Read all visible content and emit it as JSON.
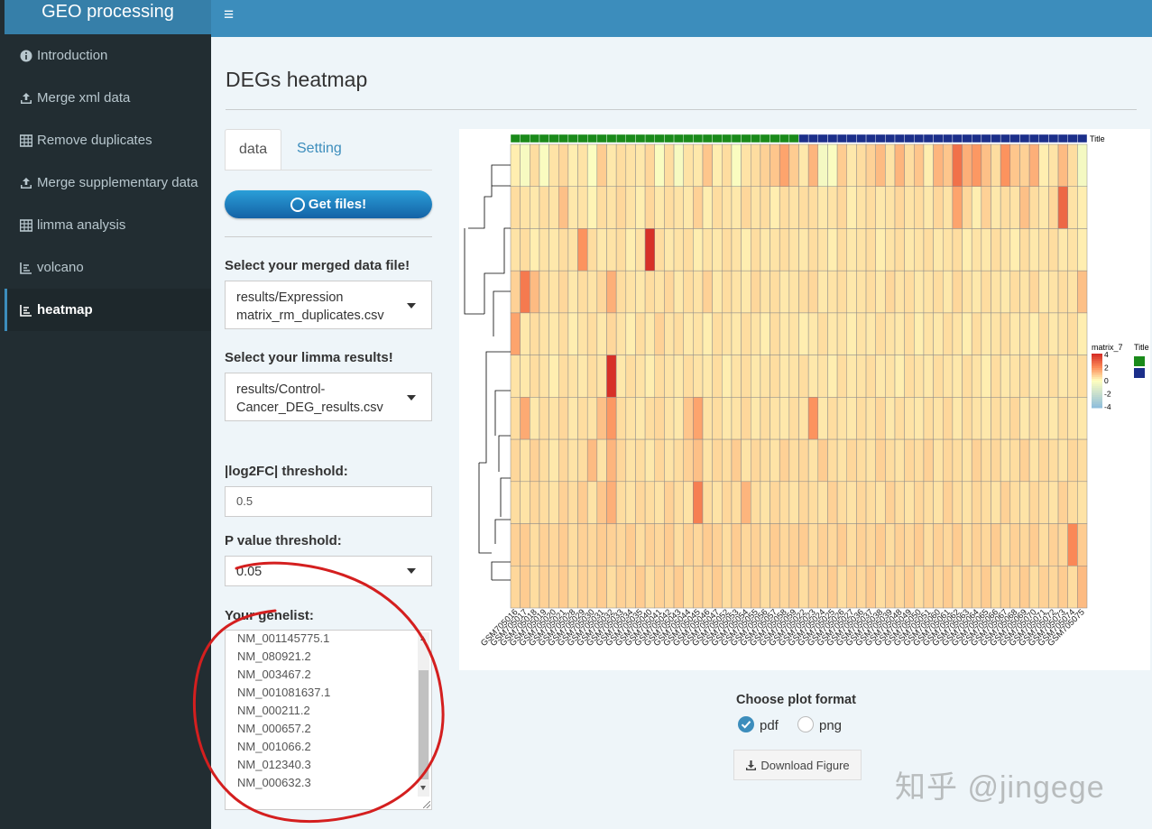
{
  "app": {
    "brand": "GEO processing",
    "menu_toggle": "≡"
  },
  "sidebar": {
    "items": [
      {
        "label": "Introduction",
        "icon": "info-circle-icon",
        "active": false
      },
      {
        "label": "Merge xml data",
        "icon": "upload-icon",
        "active": false
      },
      {
        "label": "Remove duplicates",
        "icon": "table-icon",
        "active": false
      },
      {
        "label": "Merge supplementary data",
        "icon": "upload-icon",
        "active": false
      },
      {
        "label": "limma analysis",
        "icon": "table-icon",
        "active": false
      },
      {
        "label": "volcano",
        "icon": "chart-icon",
        "active": false
      },
      {
        "label": "heatmap",
        "icon": "chart-icon",
        "active": true
      }
    ]
  },
  "page": {
    "title": "DEGs heatmap"
  },
  "tabs": [
    {
      "label": "data",
      "active": true
    },
    {
      "label": "Setting",
      "active": false
    }
  ],
  "get_files_label": "Get files!",
  "merged_file": {
    "label": "Select your merged data file!",
    "value": "results/Expression matrix_rm_duplicates.csv"
  },
  "limma_file": {
    "label": "Select your limma results!",
    "value": "results/Control-Cancer_DEG_results.csv"
  },
  "log2fc": {
    "label": "|log2FC| threshold:",
    "value": "0.5"
  },
  "pvalue": {
    "label": "P value threshold:",
    "value": "0.05"
  },
  "genelist": {
    "label": "Your genelist:",
    "items": [
      "NM_001145775.1",
      "NM_080921.2",
      "NM_003467.2",
      "NM_001081637.1",
      "NM_000211.2",
      "NM_000657.2",
      "NM_001066.2",
      "NM_012340.3",
      "NM_000632.3"
    ]
  },
  "plot_format": {
    "label": "Choose plot format",
    "options": [
      "pdf",
      "png"
    ],
    "selected": "pdf"
  },
  "download_label": "Download Figure",
  "watermark": "知乎 @jingege",
  "colors": {
    "accent": "#3c8dbc",
    "sidebar": "#222d32",
    "group1": "#1a8a1a",
    "group2": "#1c2f8a",
    "high": "#d73027",
    "mid": "#ffffbf",
    "low": "#91bfdb"
  },
  "chart_data": {
    "type": "heatmap",
    "title": "",
    "annotation_label": "Title",
    "legend_title": "matrix_7",
    "legend_ticks": [
      4,
      2,
      0,
      -2,
      -4
    ],
    "annotation_legend_title": "Title",
    "samples": [
      "GSM705016",
      "GSM705017",
      "GSM705018",
      "GSM705019",
      "GSM705020",
      "GSM705021",
      "GSM705028",
      "GSM705029",
      "GSM705030",
      "GSM705031",
      "GSM705032",
      "GSM705033",
      "GSM705034",
      "GSM705035",
      "GSM705040",
      "GSM705041",
      "GSM705042",
      "GSM705043",
      "GSM705044",
      "GSM705045",
      "GSM705046",
      "GSM705047",
      "GSM705052",
      "GSM705053",
      "GSM705054",
      "GSM705055",
      "GSM705056",
      "GSM705057",
      "GSM705058",
      "GSM705059",
      "GSM705022",
      "GSM705023",
      "GSM705024",
      "GSM705025",
      "GSM705026",
      "GSM705027",
      "GSM705036",
      "GSM705037",
      "GSM705038",
      "GSM705039",
      "GSM705048",
      "GSM705049",
      "GSM705050",
      "GSM705051",
      "GSM705060",
      "GSM705061",
      "GSM705062",
      "GSM705063",
      "GSM705064",
      "GSM705065",
      "GSM705066",
      "GSM705067",
      "GSM705068",
      "GSM705069",
      "GSM705070",
      "GSM705071",
      "GSM705072",
      "GSM705073",
      "GSM705074",
      "GSM705075"
    ],
    "group_split": 30,
    "rows": 11,
    "values": [
      [
        0.3,
        -0.3,
        0.6,
        -0.2,
        0.5,
        0.7,
        0.3,
        0.5,
        -0.1,
        0.9,
        0.4,
        0.6,
        0.5,
        0.4,
        0.7,
        -0.2,
        0.6,
        -0.3,
        0.5,
        0.4,
        1.0,
        0.3,
        0.6,
        -0.2,
        0.5,
        0.6,
        0.8,
        1.0,
        1.6,
        0.9,
        0.4,
        1.3,
        -0.4,
        -0.2,
        0.9,
        0.4,
        0.6,
        0.8,
        1.2,
        0.5,
        1.3,
        0.6,
        1.0,
        0.3,
        1.3,
        1.0,
        2.6,
        1.4,
        1.8,
        1.1,
        0.6,
        1.9,
        1.0,
        0.8,
        1.4,
        0.3,
        0.5,
        1.2,
        0.6,
        -0.4
      ],
      [
        0.6,
        0.5,
        0.4,
        0.6,
        0.5,
        1.1,
        0.4,
        0.5,
        0.2,
        0.6,
        0.5,
        0.7,
        0.5,
        0.3,
        0.7,
        0.4,
        0.6,
        0.5,
        0.4,
        0.8,
        0.3,
        0.6,
        0.5,
        0.4,
        0.7,
        0.5,
        0.6,
        0.3,
        0.6,
        0.5,
        0.6,
        0.6,
        0.4,
        0.5,
        0.7,
        0.3,
        0.5,
        0.6,
        0.4,
        0.5,
        0.7,
        0.5,
        0.6,
        0.4,
        0.7,
        0.5,
        1.6,
        0.7,
        0.3,
        0.8,
        0.4,
        0.6,
        0.5,
        1.1,
        0.6,
        0.4,
        0.7,
        2.8,
        0.5,
        0.3
      ],
      [
        0.5,
        0.6,
        0.3,
        0.5,
        0.4,
        0.6,
        0.5,
        1.9,
        0.6,
        0.4,
        0.5,
        0.6,
        0.3,
        0.5,
        4.0,
        0.6,
        0.4,
        0.5,
        0.6,
        0.3,
        0.5,
        0.4,
        0.6,
        0.5,
        0.3,
        0.6,
        0.4,
        0.5,
        0.6,
        0.5,
        0.4,
        0.6,
        0.5,
        0.3,
        0.6,
        0.4,
        0.5,
        0.6,
        0.3,
        0.5,
        0.6,
        0.4,
        0.5,
        0.6,
        0.4,
        0.5,
        0.6,
        0.3,
        0.5,
        0.4,
        0.6,
        0.5,
        0.3,
        0.6,
        0.4,
        0.5,
        0.6,
        0.4,
        0.5,
        0.3
      ],
      [
        0.8,
        2.4,
        1.2,
        0.6,
        0.5,
        0.7,
        0.4,
        0.6,
        0.5,
        0.7,
        1.4,
        0.6,
        0.5,
        0.4,
        0.6,
        0.5,
        0.7,
        0.4,
        0.6,
        0.5,
        0.8,
        0.4,
        0.6,
        0.5,
        0.4,
        0.7,
        0.5,
        0.6,
        0.4,
        0.5,
        0.6,
        0.7,
        0.4,
        0.5,
        0.6,
        0.4,
        0.5,
        0.6,
        0.4,
        0.7,
        0.5,
        0.6,
        0.4,
        0.5,
        0.6,
        0.4,
        0.7,
        0.5,
        0.4,
        0.6,
        0.5,
        0.4,
        0.6,
        0.5,
        0.7,
        0.4,
        0.5,
        0.6,
        0.5,
        1.1
      ],
      [
        1.6,
        0.4,
        0.6,
        0.5,
        0.4,
        0.6,
        0.3,
        0.5,
        0.6,
        0.4,
        0.7,
        0.5,
        0.3,
        0.6,
        0.4,
        0.8,
        0.5,
        0.6,
        0.4,
        0.5,
        0.3,
        0.6,
        0.5,
        0.4,
        0.6,
        0.5,
        0.3,
        0.6,
        0.4,
        0.5,
        0.3,
        0.4,
        0.6,
        0.4,
        0.5,
        0.3,
        0.5,
        0.4,
        0.6,
        0.5,
        0.4,
        0.6,
        0.3,
        0.5,
        0.4,
        0.6,
        0.5,
        0.3,
        0.6,
        0.4,
        0.5,
        0.6,
        0.4,
        0.5,
        0.3,
        0.6,
        0.4,
        0.5,
        0.6,
        0.3
      ],
      [
        0.5,
        0.4,
        0.6,
        0.5,
        0.3,
        0.6,
        0.5,
        0.4,
        0.6,
        0.5,
        4.0,
        0.4,
        0.6,
        0.5,
        0.3,
        0.6,
        0.5,
        0.4,
        0.6,
        0.5,
        0.4,
        0.6,
        0.3,
        0.5,
        0.6,
        0.4,
        0.5,
        0.6,
        0.4,
        0.5,
        0.6,
        0.4,
        0.5,
        0.3,
        0.6,
        0.4,
        0.5,
        0.6,
        0.4,
        0.5,
        0.3,
        0.6,
        0.5,
        0.4,
        0.6,
        0.5,
        0.4,
        0.6,
        0.5,
        0.3,
        0.6,
        0.4,
        0.5,
        0.6,
        0.4,
        0.5,
        0.6,
        0.4,
        0.5,
        0.6
      ],
      [
        0.6,
        1.5,
        0.4,
        0.6,
        0.5,
        0.7,
        0.4,
        0.6,
        0.5,
        1.1,
        1.8,
        0.6,
        0.5,
        0.4,
        0.6,
        0.7,
        0.5,
        0.4,
        1.0,
        1.6,
        0.5,
        0.6,
        0.4,
        0.5,
        0.7,
        0.4,
        0.6,
        0.5,
        0.4,
        0.6,
        0.5,
        1.9,
        0.4,
        0.6,
        0.5,
        0.4,
        0.6,
        0.5,
        0.7,
        0.4,
        0.6,
        0.5,
        0.4,
        0.6,
        0.5,
        0.7,
        0.4,
        0.6,
        0.5,
        0.4,
        0.6,
        0.5,
        0.7,
        0.4,
        0.6,
        0.5,
        0.4,
        0.6,
        0.5,
        0.4
      ],
      [
        0.7,
        0.5,
        0.8,
        0.6,
        0.4,
        0.7,
        0.5,
        0.6,
        1.2,
        0.5,
        1.3,
        0.7,
        0.5,
        0.6,
        0.4,
        0.7,
        0.5,
        0.6,
        0.8,
        1.1,
        0.5,
        0.7,
        0.6,
        0.9,
        0.5,
        0.7,
        0.6,
        0.5,
        0.8,
        0.6,
        0.7,
        0.5,
        0.9,
        0.6,
        0.5,
        0.7,
        0.6,
        0.5,
        0.8,
        0.6,
        0.5,
        0.7,
        0.6,
        0.8,
        0.5,
        0.7,
        0.6,
        0.5,
        0.8,
        0.6,
        0.7,
        0.5,
        0.6,
        0.8,
        0.5,
        0.7,
        0.6,
        0.5,
        0.7,
        0.6
      ],
      [
        0.6,
        0.5,
        0.7,
        0.6,
        0.5,
        0.8,
        0.6,
        0.9,
        0.5,
        1.0,
        1.4,
        0.6,
        0.5,
        0.7,
        0.6,
        0.5,
        0.8,
        0.6,
        0.5,
        2.3,
        0.6,
        0.5,
        0.7,
        0.6,
        1.3,
        0.6,
        0.5,
        0.7,
        0.6,
        0.5,
        0.7,
        0.6,
        0.5,
        0.8,
        0.6,
        0.5,
        0.7,
        0.6,
        0.5,
        0.8,
        0.6,
        0.5,
        0.7,
        0.6,
        0.5,
        0.8,
        0.6,
        0.5,
        0.7,
        0.6,
        0.5,
        0.8,
        0.6,
        0.5,
        0.7,
        0.6,
        0.5,
        0.8,
        0.6,
        0.5
      ],
      [
        0.8,
        0.9,
        0.6,
        0.8,
        0.7,
        0.9,
        0.6,
        0.8,
        0.7,
        0.9,
        0.8,
        0.7,
        0.9,
        0.6,
        0.8,
        0.7,
        0.9,
        0.6,
        0.8,
        0.7,
        0.9,
        0.8,
        0.6,
        0.9,
        0.7,
        0.8,
        0.6,
        0.9,
        0.7,
        0.8,
        0.9,
        0.6,
        0.8,
        0.7,
        0.9,
        0.6,
        0.8,
        0.7,
        0.9,
        0.6,
        0.8,
        0.7,
        0.9,
        0.6,
        0.8,
        0.7,
        0.9,
        0.6,
        0.8,
        0.7,
        0.9,
        0.6,
        0.8,
        0.7,
        0.9,
        0.6,
        0.8,
        0.7,
        2.1,
        0.9
      ],
      [
        0.7,
        0.9,
        0.6,
        0.8,
        0.7,
        0.9,
        0.6,
        0.8,
        0.7,
        0.9,
        0.6,
        0.8,
        0.7,
        0.9,
        0.6,
        0.8,
        0.7,
        0.9,
        0.6,
        0.8,
        0.7,
        0.9,
        0.6,
        0.8,
        0.7,
        0.9,
        0.6,
        0.8,
        0.7,
        0.9,
        0.6,
        0.8,
        0.7,
        0.9,
        0.6,
        0.8,
        0.7,
        0.9,
        0.6,
        0.8,
        0.7,
        0.9,
        0.6,
        0.8,
        0.7,
        0.9,
        0.6,
        0.8,
        0.7,
        0.9,
        0.6,
        0.8,
        0.7,
        0.9,
        0.6,
        0.8,
        0.7,
        0.9,
        0.6,
        1.2
      ]
    ]
  }
}
